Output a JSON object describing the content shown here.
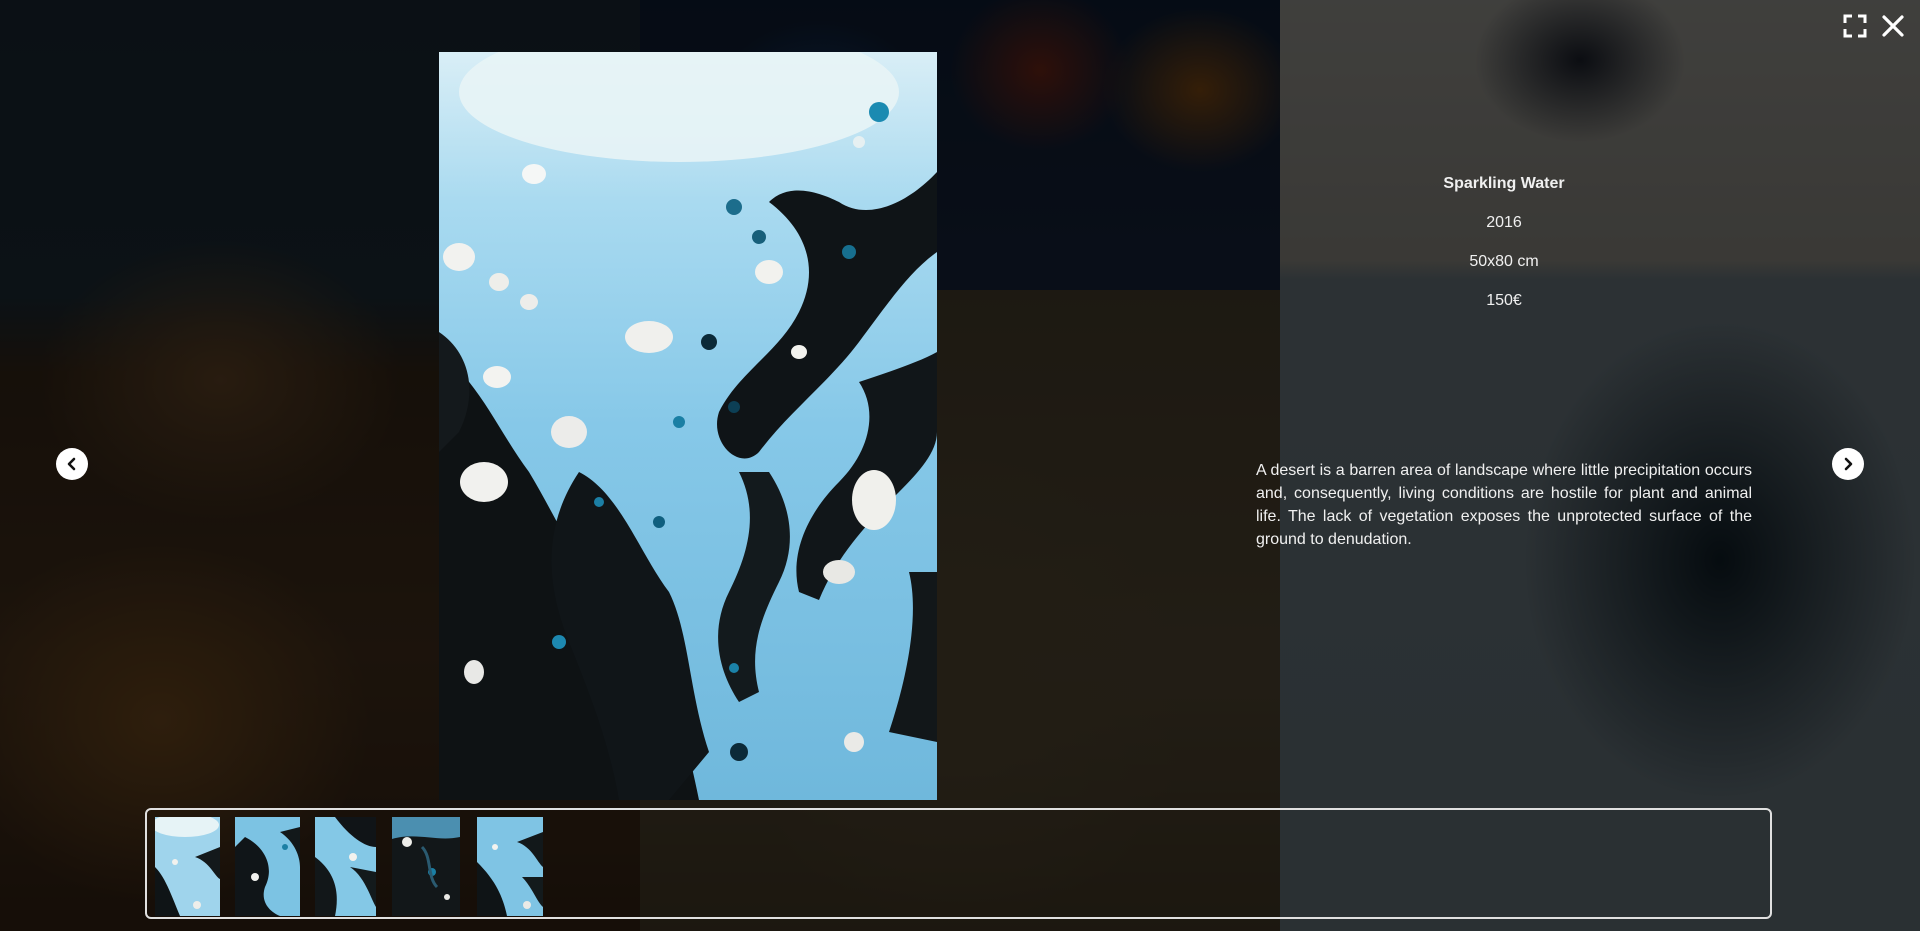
{
  "artwork": {
    "title": "Sparkling Water",
    "year": "2016",
    "dimensions": "50x80 cm",
    "price": "150€",
    "description": "A desert is a barren area of landscape where little precipitation occurs and, consequently, living conditions are hostile for plant and animal life. The lack of vegetation exposes the unprotected surface of the ground to denudation."
  },
  "controls": {
    "fullscreen_icon": "fullscreen-icon",
    "close_icon": "close-icon",
    "prev_icon": "chevron-left-icon",
    "next_icon": "chevron-right-icon"
  },
  "thumbnails": [
    {
      "name": "thumbnail-1",
      "palette": "light"
    },
    {
      "name": "thumbnail-2",
      "palette": "mixed"
    },
    {
      "name": "thumbnail-3",
      "palette": "mixed"
    },
    {
      "name": "thumbnail-4",
      "palette": "dark"
    },
    {
      "name": "thumbnail-5",
      "palette": "mixed"
    }
  ],
  "colors": {
    "text": "#f0f0f0",
    "overlay": "rgba(0,0,0,0.62)",
    "paint_blue": "#7ec3e4",
    "paint_dark": "#0e1214"
  }
}
